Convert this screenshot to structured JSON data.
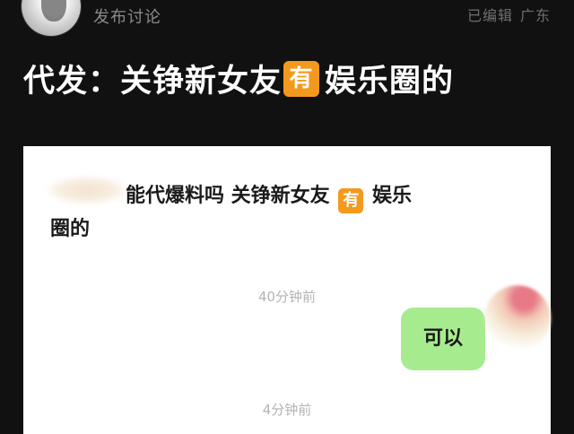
{
  "header": {
    "post_type": "发布讨论",
    "edited_label": "已编辑",
    "location": "广东"
  },
  "post": {
    "title_before": "代发：关铮新女友",
    "title_emoji": "有",
    "title_after": "娱乐圈的"
  },
  "chat": {
    "incoming_line1": "能代爆料吗 关铮新女友",
    "incoming_emoji": "有",
    "incoming_line1_after": " 娱乐",
    "incoming_line2": "圈的",
    "timestamp_1": "40分钟前",
    "outgoing": "可以",
    "timestamp_2": "4分钟前"
  },
  "colors": {
    "background": "#111111",
    "emoji_orange": "#f39a1e",
    "bubble_green": "#a6ec8e"
  }
}
